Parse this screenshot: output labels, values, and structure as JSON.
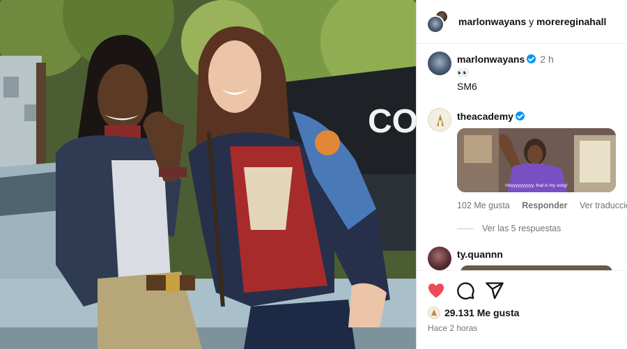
{
  "post": {
    "header": {
      "user1": "marlonwayans",
      "separator": "y",
      "user2": "moreregina hall",
      "user2_display": "morereginahall"
    },
    "caption": {
      "username": "marlonwayans",
      "time": "2 h",
      "emoji": "👀",
      "text": "SM6"
    },
    "comment": {
      "username": "theacademy",
      "gif_text": "Heyyyyyyyyyy, that is my song!",
      "likes": "102 Me gusta",
      "reply": "Responder",
      "translate": "Ver traducción",
      "view_replies": "Ver las 5 respuestas"
    },
    "next_comment": {
      "username": "ty.quannn"
    },
    "photo": {
      "sign_text": "CO"
    },
    "footer": {
      "likes": "29.131 Me gusta",
      "time": "Hace 2 horas"
    },
    "icons": {
      "like": "heart-icon",
      "comment": "comment-icon",
      "share": "share-icon",
      "verified": "verified-badge-icon"
    },
    "colors": {
      "like": "#ed4956",
      "verified": "#0095f6",
      "muted": "#737373"
    }
  }
}
